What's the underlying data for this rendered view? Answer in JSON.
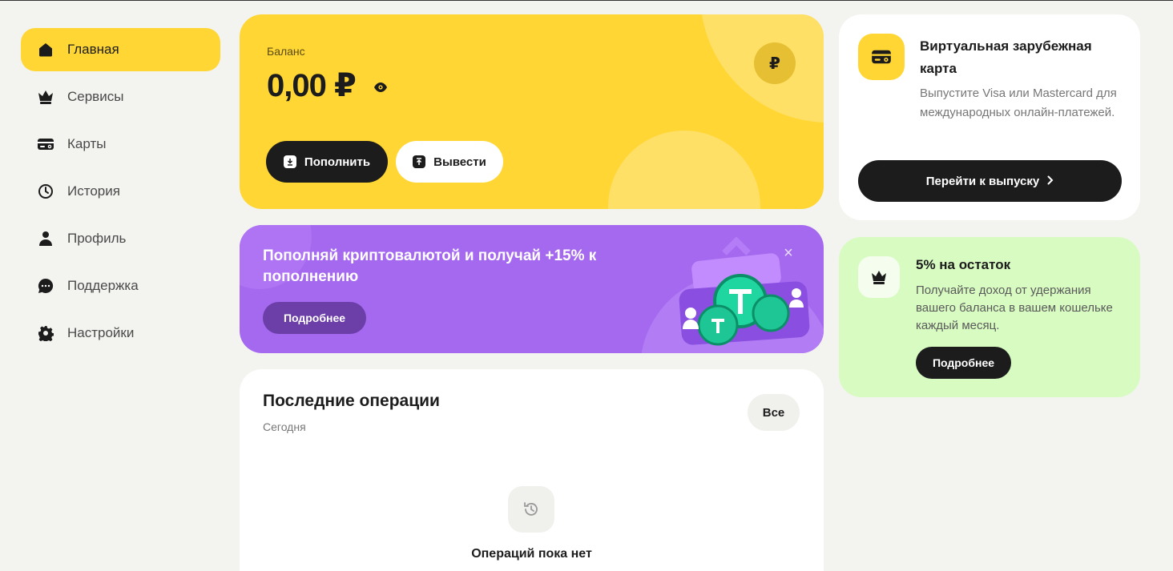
{
  "sidebar": {
    "items": [
      {
        "label": "Главная",
        "icon": "home-icon",
        "active": true
      },
      {
        "label": "Сервисы",
        "icon": "crown-icon"
      },
      {
        "label": "Карты",
        "icon": "card-icon"
      },
      {
        "label": "История",
        "icon": "history-icon"
      },
      {
        "label": "Профиль",
        "icon": "user-icon"
      },
      {
        "label": "Поддержка",
        "icon": "chat-icon"
      },
      {
        "label": "Настройки",
        "icon": "gear-icon"
      }
    ]
  },
  "balance": {
    "label": "Баланс",
    "value": "0,00 ₽",
    "currency_symbol": "₽",
    "topup_label": "Пополнить",
    "withdraw_label": "Вывести"
  },
  "promo": {
    "title": "Пополняй криптовалютой и получай +15% к пополнению",
    "button_label": "Подробнее",
    "close_glyph": "×"
  },
  "operations": {
    "title": "Последние операции",
    "subtitle": "Сегодня",
    "all_label": "Все",
    "empty_text": "Операций пока нет"
  },
  "virtual_card": {
    "title": "Виртуальная зарубежная карта",
    "description": "Выпустите Visa или Mastercard для международных онлайн-платежей.",
    "button_label": "Перейти к выпуску"
  },
  "cashback": {
    "title": "5% на остаток",
    "description": "Получайте доход от удержания вашего баланса в вашем кошельке каждый месяц.",
    "button_label": "Подробнее"
  },
  "colors": {
    "accent_yellow": "#ffd633",
    "promo_purple": "#a569f0",
    "cashback_green": "#d8fbc2",
    "dark": "#1c1c1c"
  }
}
